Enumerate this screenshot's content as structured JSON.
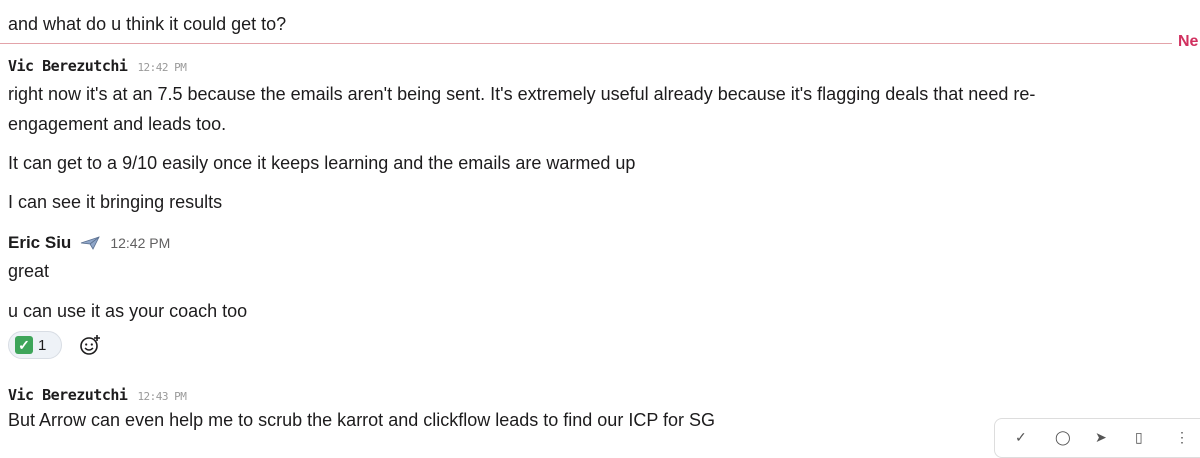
{
  "messages": {
    "prev_line": "and what do u think it could get to?",
    "new_divider_label": "Ne",
    "vic1": {
      "sender": "Vic Berezutchi",
      "time": "12:42 PM",
      "lines": [
        "right now it's at an 7.5 because the emails aren't being sent. It's extremely useful already because it's flagging deals that need re-",
        "engagement and leads too.",
        "It can get to a 9/10 easily once it keeps learning and the emails are warmed up",
        "I can see it bringing results"
      ]
    },
    "eric": {
      "sender": "Eric Siu",
      "time": "12:42 PM",
      "lines": [
        "great",
        "u can use it as your coach too"
      ],
      "reaction": {
        "emoji": "✓",
        "count": "1"
      }
    },
    "vic2": {
      "sender": "Vic Berezutchi",
      "time": "12:43 PM",
      "lines": [
        "But Arrow can even help me to scrub the karrot and clickflow leads to find our ICP for SG"
      ]
    }
  },
  "colors": {
    "divider": "#e3a3a9",
    "new_label": "#d1305f",
    "reaction_check": "#3ea55a"
  },
  "icons": [
    "add-reaction-icon",
    "checkmark-icon",
    "airplane-badge-icon"
  ]
}
